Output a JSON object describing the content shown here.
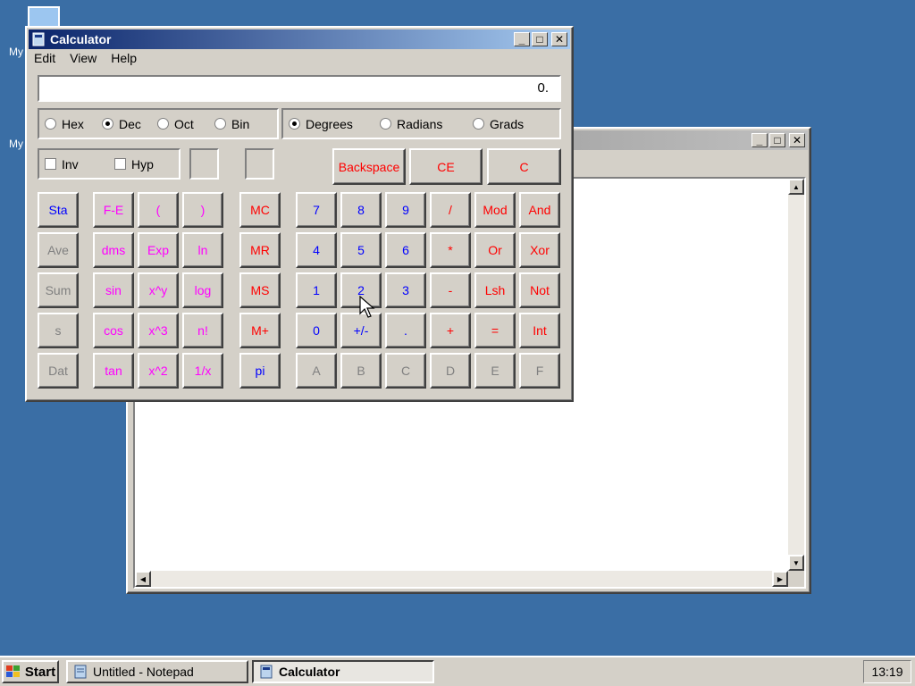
{
  "desktop": {
    "icon1_label": "My",
    "icon2_label": "My"
  },
  "calculator": {
    "title": "Calculator",
    "menu": [
      "Edit",
      "View",
      "Help"
    ],
    "display_value": "0.",
    "number_systems": [
      {
        "label": "Hex",
        "selected": false
      },
      {
        "label": "Dec",
        "selected": true
      },
      {
        "label": "Oct",
        "selected": false
      },
      {
        "label": "Bin",
        "selected": false
      }
    ],
    "angle_units": [
      {
        "label": "Degrees",
        "selected": true
      },
      {
        "label": "Radians",
        "selected": false
      },
      {
        "label": "Grads",
        "selected": false
      }
    ],
    "checkboxes": [
      {
        "label": "Inv",
        "checked": false
      },
      {
        "label": "Hyp",
        "checked": false
      }
    ],
    "edit_buttons": [
      "Backspace",
      "CE",
      "C"
    ],
    "stat_buttons": [
      "Sta",
      "Ave",
      "Sum",
      "s",
      "Dat"
    ],
    "sci_buttons": [
      [
        "F-E",
        "(",
        ")"
      ],
      [
        "dms",
        "Exp",
        "ln"
      ],
      [
        "sin",
        "x^y",
        "log"
      ],
      [
        "cos",
        "x^3",
        "n!"
      ],
      [
        "tan",
        "x^2",
        "1/x"
      ]
    ],
    "mem_buttons": [
      "MC",
      "MR",
      "MS",
      "M+",
      "pi"
    ],
    "num_buttons": [
      [
        "7",
        "8",
        "9",
        "/",
        "Mod",
        "And"
      ],
      [
        "4",
        "5",
        "6",
        "*",
        "Or",
        "Xor"
      ],
      [
        "1",
        "2",
        "3",
        "-",
        "Lsh",
        "Not"
      ],
      [
        "0",
        "+/-",
        ".",
        "+",
        "=",
        "Int"
      ],
      [
        "A",
        "B",
        "C",
        "D",
        "E",
        "F"
      ]
    ]
  },
  "taskbar": {
    "start_label": "Start",
    "tasks": [
      {
        "label": "Untitled - Notepad",
        "active": false
      },
      {
        "label": "Calculator",
        "active": true
      }
    ],
    "clock": "13:19"
  },
  "colors": {
    "desktop": "#3a6ea5",
    "title_active": "#0a246a",
    "digit": "#0000ff",
    "operator": "#ff0000",
    "function": "#ff00ff",
    "disabled": "#808080"
  }
}
